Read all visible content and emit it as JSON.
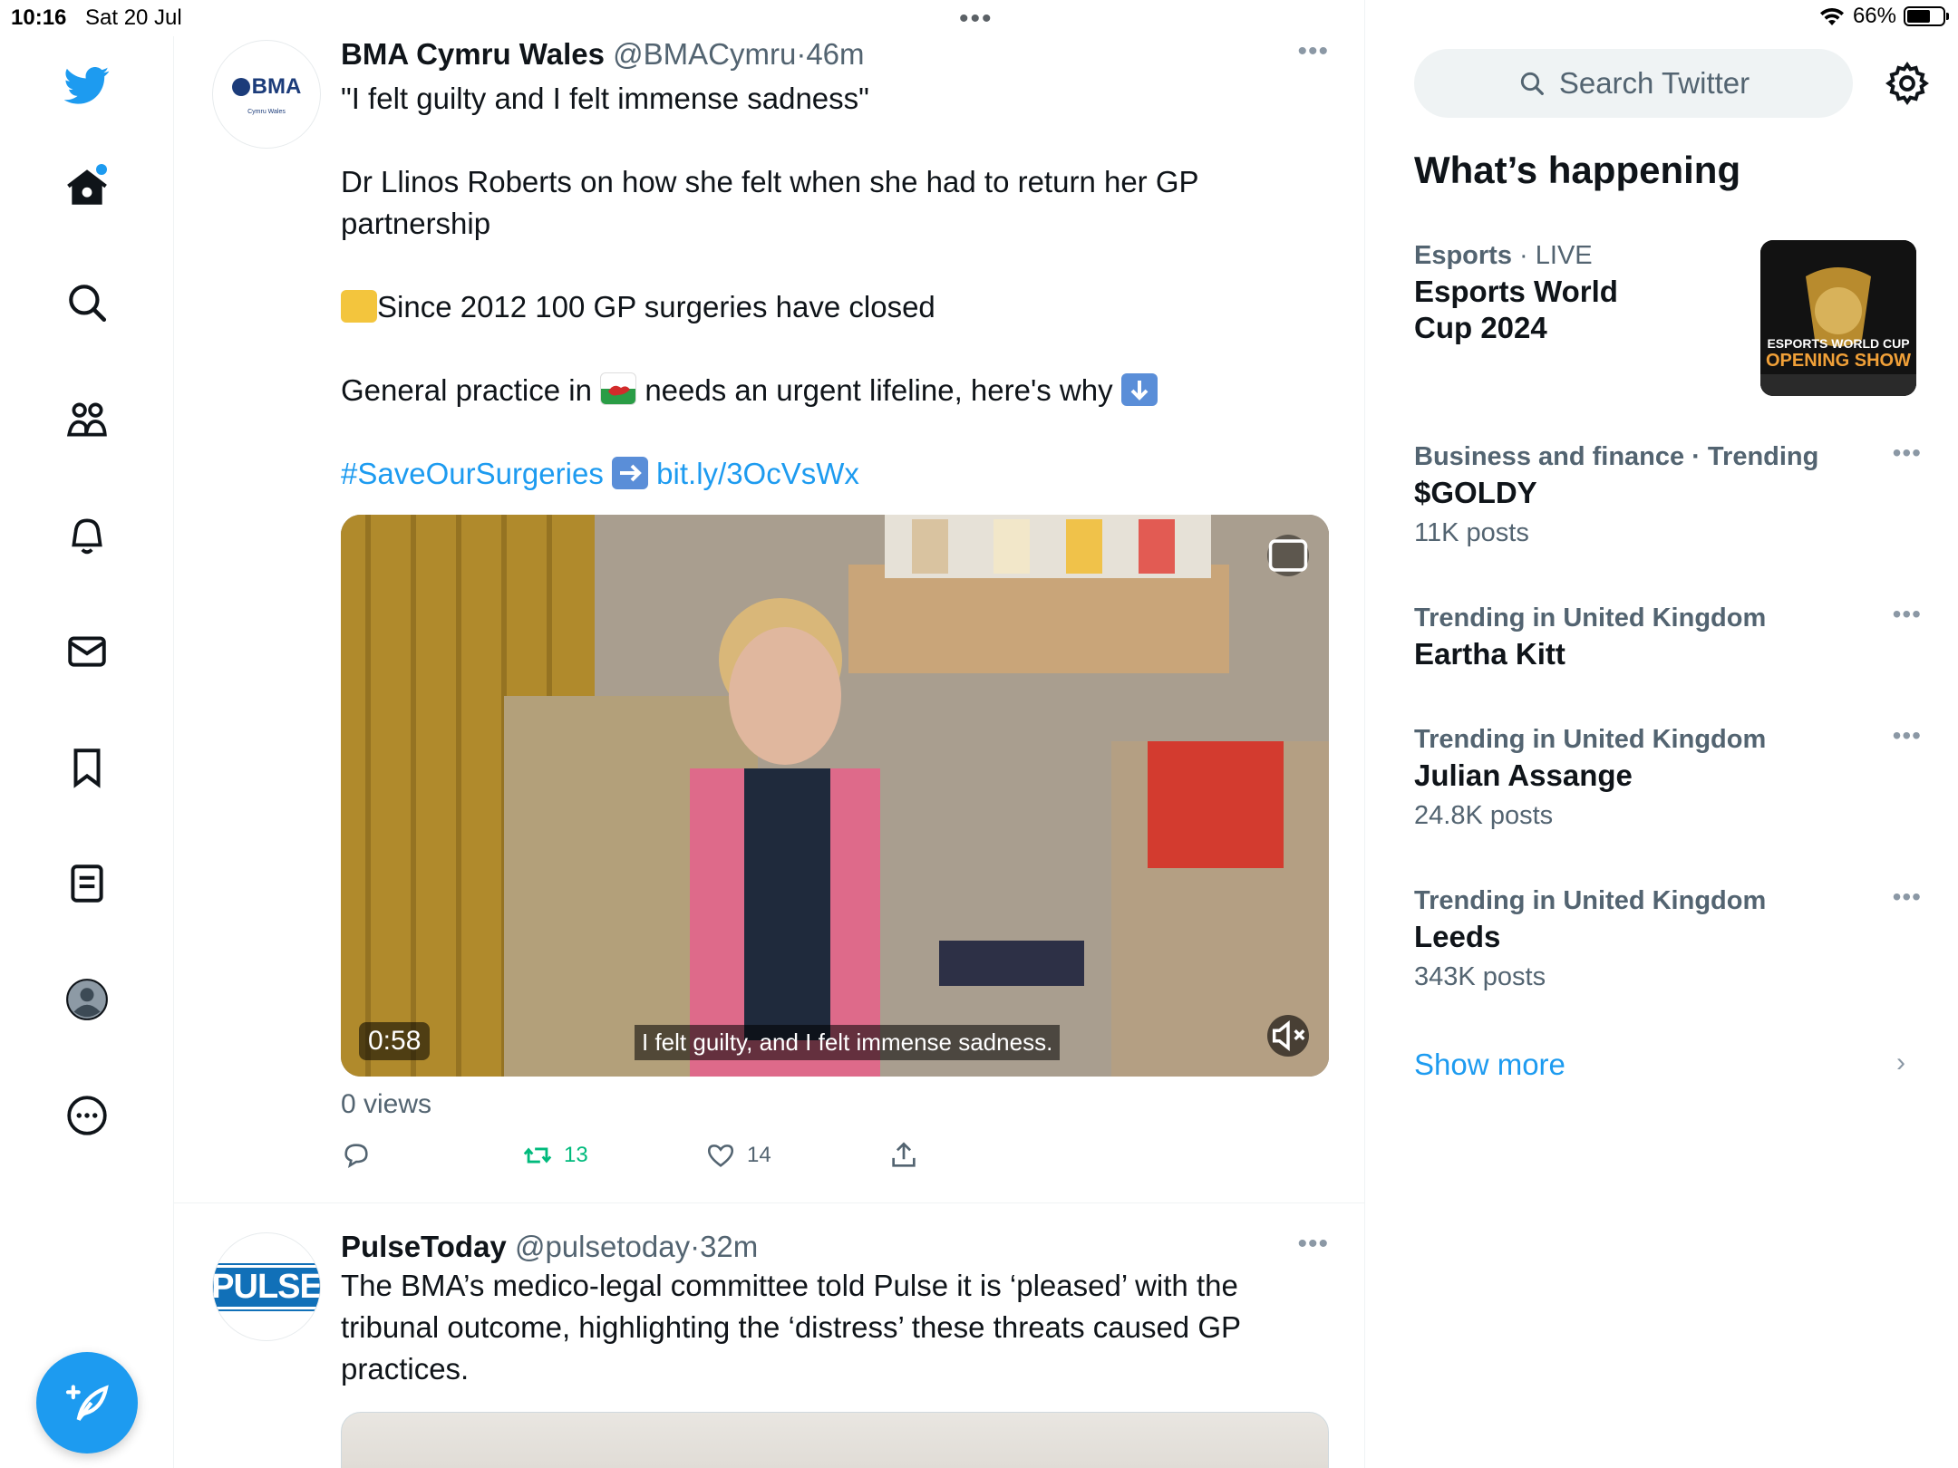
{
  "status_bar": {
    "time": "10:16",
    "date": "Sat 20 Jul",
    "battery": "66%",
    "battery_level": 0.66
  },
  "nav": {
    "items": [
      "twitter-logo",
      "home-icon",
      "search-icon",
      "communities-icon",
      "notifications-icon",
      "messages-icon",
      "bookmarks-icon",
      "lists-icon",
      "profile-avatar",
      "more-icon"
    ],
    "compose_icon": "compose-tweet-icon"
  },
  "tweets": [
    {
      "name": "BMA Cymru Wales",
      "handle": "@BMACymru",
      "sep": "·",
      "time": "46m",
      "avatar_text": "BMA",
      "avatar_sub": "Cymru Wales",
      "lines": {
        "quote": "\"I felt guilty and I felt immense sadness\"",
        "story": "Dr Llinos Roberts on how she felt when she had to return her GP partnership",
        "closed": "Since 2012 100 GP surgeries have closed",
        "practice_a": "General practice in",
        "practice_b": "needs an urgent lifeline, here's why",
        "hashtag": "#SaveOurSurgeries",
        "link": "bit.ly/3OcVsWx"
      },
      "video": {
        "duration": "0:58",
        "caption": "I felt guilty, and I felt immense sadness."
      },
      "views": "0 views",
      "retweets": "13",
      "likes": "14",
      "colors": {
        "retweet": "#00ba7c"
      }
    },
    {
      "name": "PulseToday",
      "handle": "@pulsetoday",
      "sep": "·",
      "time": "32m",
      "avatar_text": "PULSE",
      "text": "The BMA’s medico-legal committee told Pulse it is ‘pleased’ with the tribunal outcome, highlighting the ‘distress’ these threats caused GP practices."
    }
  ],
  "sidebar": {
    "search_placeholder": "Search Twitter",
    "heading": "What’s happening",
    "trends": [
      {
        "category": "Esports",
        "extra": "· LIVE",
        "title": "Esports World Cup 2024",
        "posts": "",
        "image_label": "ESPORTS WORLD CUP",
        "image_sub": "OPENING SHOW"
      },
      {
        "category": "Business and finance · Trending",
        "extra": "",
        "title": "$GOLDY",
        "posts": "11K posts"
      },
      {
        "category": "Trending in United Kingdom",
        "extra": "",
        "title": "Eartha Kitt",
        "posts": ""
      },
      {
        "category": "Trending in United Kingdom",
        "extra": "",
        "title": "Julian Assange",
        "posts": "24.8K posts"
      },
      {
        "category": "Trending in United Kingdom",
        "extra": "",
        "title": "Leeds",
        "posts": "343K posts"
      }
    ],
    "show_more": "Show more"
  },
  "colors": {
    "accent": "#1d9bf0",
    "text": "#0f1419",
    "muted": "#536471"
  }
}
